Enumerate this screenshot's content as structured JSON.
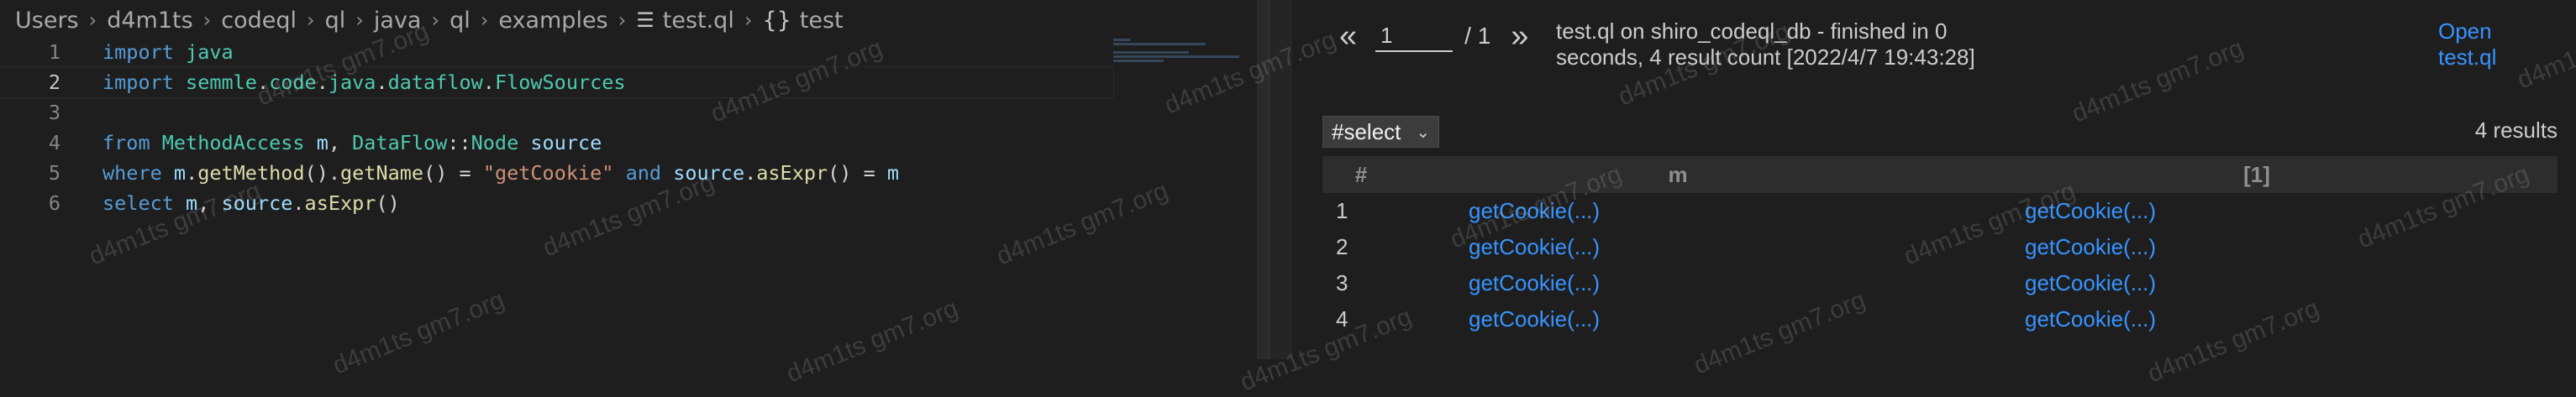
{
  "breadcrumb": {
    "items": [
      "Users",
      "d4m1ts",
      "codeql",
      "ql",
      "java",
      "ql",
      "examples"
    ],
    "file": "test.ql",
    "symbol": "test"
  },
  "code_lines": [
    {
      "num": "1",
      "tokens": [
        {
          "t": "import",
          "c": "kw"
        },
        {
          "t": " ",
          "c": "op"
        },
        {
          "t": "java",
          "c": "ty"
        }
      ]
    },
    {
      "num": "2",
      "tokens": [
        {
          "t": "import",
          "c": "kw"
        },
        {
          "t": " ",
          "c": "op"
        },
        {
          "t": "semmle",
          "c": "ty"
        },
        {
          "t": ".",
          "c": "op"
        },
        {
          "t": "code",
          "c": "ty"
        },
        {
          "t": ".",
          "c": "op"
        },
        {
          "t": "java",
          "c": "ty"
        },
        {
          "t": ".",
          "c": "op"
        },
        {
          "t": "dataflow",
          "c": "ty"
        },
        {
          "t": ".",
          "c": "op"
        },
        {
          "t": "FlowSources",
          "c": "ty"
        }
      ]
    },
    {
      "num": "3",
      "tokens": []
    },
    {
      "num": "4",
      "tokens": [
        {
          "t": "from",
          "c": "kw"
        },
        {
          "t": " ",
          "c": "op"
        },
        {
          "t": "MethodAccess",
          "c": "ty"
        },
        {
          "t": " ",
          "c": "op"
        },
        {
          "t": "m",
          "c": "va"
        },
        {
          "t": ", ",
          "c": "op"
        },
        {
          "t": "DataFlow",
          "c": "ty"
        },
        {
          "t": "::",
          "c": "op"
        },
        {
          "t": "Node",
          "c": "ty"
        },
        {
          "t": " ",
          "c": "op"
        },
        {
          "t": "source",
          "c": "va"
        }
      ]
    },
    {
      "num": "5",
      "tokens": [
        {
          "t": "where",
          "c": "kw"
        },
        {
          "t": " ",
          "c": "op"
        },
        {
          "t": "m",
          "c": "va"
        },
        {
          "t": ".",
          "c": "op"
        },
        {
          "t": "getMethod",
          "c": "fn"
        },
        {
          "t": "().",
          "c": "op"
        },
        {
          "t": "getName",
          "c": "fn"
        },
        {
          "t": "() = ",
          "c": "op"
        },
        {
          "t": "\"getCookie\"",
          "c": "st"
        },
        {
          "t": " ",
          "c": "op"
        },
        {
          "t": "and",
          "c": "kw"
        },
        {
          "t": " ",
          "c": "op"
        },
        {
          "t": "source",
          "c": "va"
        },
        {
          "t": ".",
          "c": "op"
        },
        {
          "t": "asExpr",
          "c": "fn"
        },
        {
          "t": "() = ",
          "c": "op"
        },
        {
          "t": "m",
          "c": "va"
        }
      ]
    },
    {
      "num": "6",
      "tokens": [
        {
          "t": "select",
          "c": "kw"
        },
        {
          "t": " ",
          "c": "op"
        },
        {
          "t": "m",
          "c": "va"
        },
        {
          "t": ", ",
          "c": "op"
        },
        {
          "t": "source",
          "c": "va"
        },
        {
          "t": ".",
          "c": "op"
        },
        {
          "t": "asExpr",
          "c": "fn"
        },
        {
          "t": "()",
          "c": "op"
        }
      ]
    }
  ],
  "results": {
    "prev_label": "«",
    "next_label": "»",
    "page_value": "1",
    "page_total": "/ 1",
    "status": "test.ql on shiro_codeql_db - finished in 0 seconds, 4 result count [2022/4/7 19:43:28]",
    "open_link": "Open test.ql",
    "select_value": "#select",
    "result_count": "4 results",
    "columns": [
      "#",
      "m",
      "[1]"
    ],
    "rows": [
      {
        "idx": "1",
        "m": "getCookie(...)",
        "c1": "getCookie(...)"
      },
      {
        "idx": "2",
        "m": "getCookie(...)",
        "c1": "getCookie(...)"
      },
      {
        "idx": "3",
        "m": "getCookie(...)",
        "c1": "getCookie(...)"
      },
      {
        "idx": "4",
        "m": "getCookie(...)",
        "c1": "getCookie(...)"
      }
    ]
  },
  "watermark_text": "d4m1ts gm7.org",
  "colors": {
    "link": "#3794ff",
    "keyword": "#569cd6",
    "type": "#4ec9b0",
    "function": "#dcdcaa",
    "variable": "#9cdcfe",
    "string": "#ce9178"
  }
}
